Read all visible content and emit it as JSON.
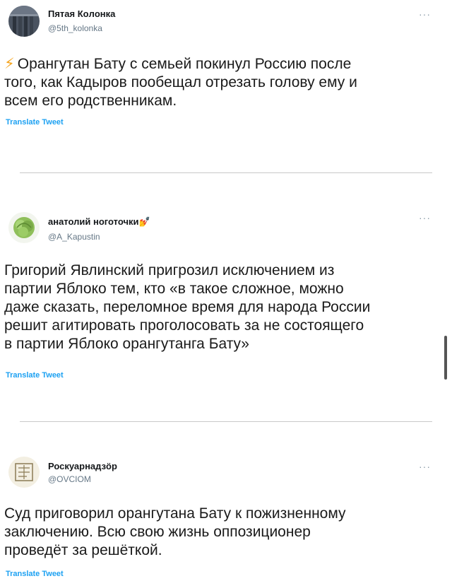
{
  "tweets": [
    {
      "name": "Пятая Кoлoнка",
      "handle": "@5th_kolonka",
      "more": "···",
      "text_prefix_icon": "⚡",
      "lines": [
        "Орангутан Бату с семьей покинул Россию после",
        "того, как Кадыров пообещал отрезать голову ему и",
        "всем его родственникам."
      ],
      "translate": "Translate Tweet",
      "avatar_icon": "building-avatar"
    },
    {
      "name": "анатолий ноготочки💅",
      "handle": "@A_Kapustin",
      "more": "···",
      "lines": [
        "Григорий Явлинский пригрозил исключением из",
        "партии Яблоко тем, кто «в такое сложное, можно",
        "даже сказать, переломное время для народа России",
        "решит агитировать проголосовать за не состоящего",
        "в партии Яблоко орангутанга Бату»"
      ],
      "translate": "Translate Tweet",
      "avatar_icon": "cabbage-avatar"
    },
    {
      "name": "Роскуарнадзöр",
      "handle": "@OVCIOM",
      "more": "···",
      "lines": [
        "Суд приговорил орангутана Бату к пожизненному",
        "заключению. Всю свою жизнь оппозиционер",
        "проведёт за решёткой."
      ],
      "translate": "Translate Tweet",
      "avatar_icon": "stamp-avatar"
    }
  ],
  "colors": {
    "link": "#1da1f2",
    "handle": "#657786",
    "divider": "#c9c9c9"
  }
}
